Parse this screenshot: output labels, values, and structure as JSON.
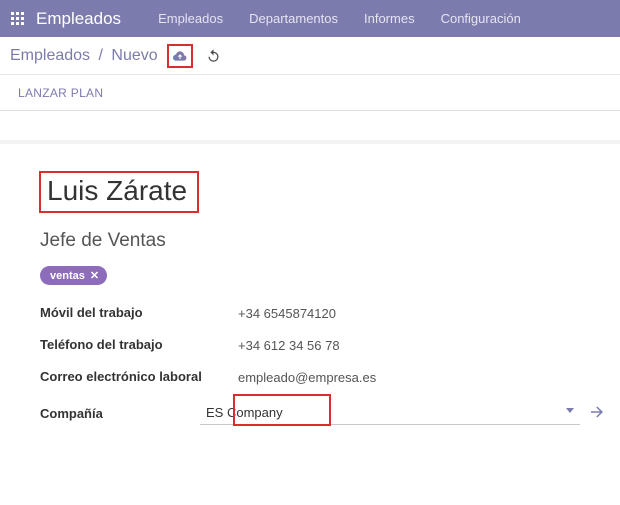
{
  "topnav": {
    "brand": "Empleados",
    "menu": [
      "Empleados",
      "Departamentos",
      "Informes",
      "Configuración"
    ]
  },
  "breadcrumb": {
    "root": "Empleados",
    "current": "Nuevo"
  },
  "subbar": {
    "launch_plan": "LANZAR PLAN"
  },
  "employee": {
    "name": "Luis Zárate",
    "job_title": "Jefe de Ventas",
    "tag": "ventas"
  },
  "fields": {
    "work_mobile_label": "Móvil del trabajo",
    "work_mobile_value": "+34 6545874120",
    "work_phone_label": "Teléfono del trabajo",
    "work_phone_value": "+34 612 34 56 78",
    "work_email_label": "Correo electrónico laboral",
    "work_email_value": "empleado@empresa.es",
    "company_label": "Compañía",
    "company_value": "ES Company"
  }
}
